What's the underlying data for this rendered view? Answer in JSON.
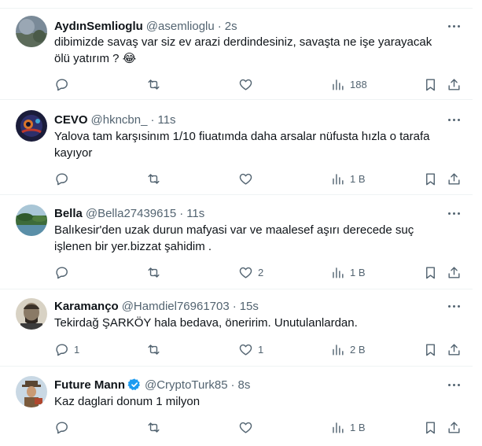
{
  "tweets": [
    {
      "name": "AydınSemlioglu",
      "handle": "@asemlioglu",
      "time": "2s",
      "text": "dibimizde savaş var siz ev arazi derdindesiniz, savaşta ne işe yarayacak ölü yatırım ? 😂",
      "replies": "",
      "likes": "",
      "views": "188",
      "verified": false
    },
    {
      "name": "CEVO",
      "handle": "@hkncbn_",
      "time": "11s",
      "text": "Yalova tam karşısinım 1/10 fiuatımda daha arsalar nüfusta hızla o tarafa kayıyor",
      "replies": "",
      "likes": "",
      "views": "1 B",
      "verified": false
    },
    {
      "name": "Bella",
      "handle": "@Bella27439615",
      "time": "11s",
      "text": "Balıkesir'den uzak durun mafyasi var ve maalesef aşırı derecede suç işlenen bir yer.bizzat şahidim .",
      "replies": "",
      "likes": "2",
      "views": "1 B",
      "verified": false
    },
    {
      "name": "Karamanço",
      "handle": "@Hamdiel76961703",
      "time": "15s",
      "text": "Tekirdağ ŞARKÖY hala bedava, öneririm. Unutulanlardan.",
      "replies": "1",
      "likes": "1",
      "views": "2 B",
      "verified": false
    },
    {
      "name": "Future Mann",
      "handle": "@CryptoTurk85",
      "time": "8s",
      "text": "Kaz daglari donum 1 milyon",
      "replies": "",
      "likes": "",
      "views": "1 B",
      "verified": true
    }
  ],
  "separator": "·",
  "icons": [
    "reply-icon",
    "retweet-icon",
    "like-icon",
    "views-icon",
    "bookmark-icon",
    "share-icon",
    "more-icon",
    "verified-badge-icon"
  ],
  "colors": {
    "text": "#0f1419",
    "secondary": "#536471",
    "divider": "#eff3f4",
    "verified": "#1d9bf0"
  }
}
